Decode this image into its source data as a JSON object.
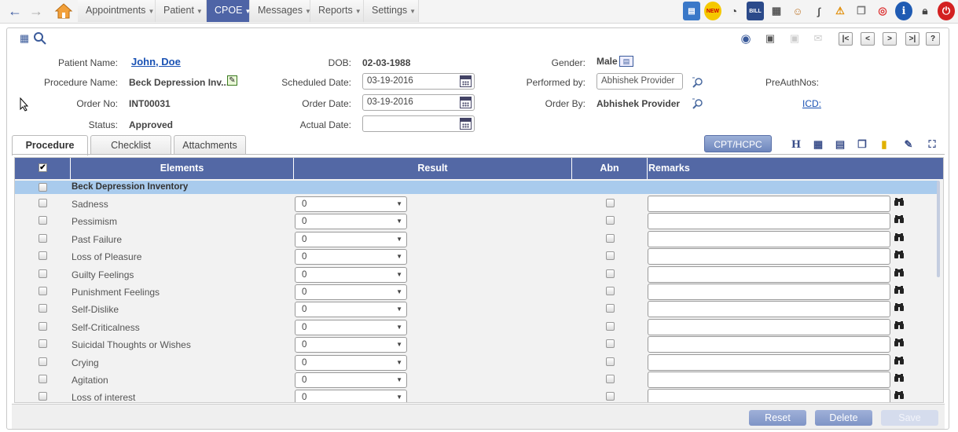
{
  "nav": {
    "back_icon": "back-arrow-icon",
    "forward_icon": "forward-arrow-icon",
    "home_icon": "home-icon",
    "menu": [
      {
        "label": "Appointments"
      },
      {
        "label": "Patient"
      },
      {
        "label": "CPOE"
      },
      {
        "label": "Messages"
      },
      {
        "label": "Reports"
      },
      {
        "label": "Settings"
      }
    ],
    "active_menu": "CPOE",
    "tool_new_label": "NEW",
    "tool_bill_label": "BILL"
  },
  "patient": {
    "name_label": "Patient Name:",
    "name": "John, Doe",
    "dob_label": "DOB:",
    "dob": "02-03-1988",
    "gender_label": "Gender:",
    "gender": "Male",
    "procedure_label": "Procedure Name:",
    "procedure": "Beck Depression Inv...",
    "scheduled_label": "Scheduled Date:",
    "scheduled": "03-19-2016",
    "performed_label": "Performed by:",
    "performed": "Abhishek Provider",
    "preauth_label": "PreAuthNos:",
    "order_no_label": "Order No:",
    "order_no": "INT00031",
    "order_date_label": "Order Date:",
    "order_date": "03-19-2016",
    "order_by_label": "Order By:",
    "order_by": "Abhishek Provider",
    "icd_label": "ICD:",
    "status_label": "Status:",
    "status": "Approved",
    "actual_label": "Actual Date:",
    "actual": ""
  },
  "tabs": [
    {
      "label": "Procedure"
    },
    {
      "label": "Checklist"
    },
    {
      "label": "Attachments"
    }
  ],
  "cpt_button": "CPT/HCPC",
  "table": {
    "headers": [
      "Elements",
      "Result",
      "Abn",
      "Remarks"
    ],
    "group": "Beck Depression Inventory",
    "rows": [
      {
        "element": "Sadness",
        "result": "0"
      },
      {
        "element": "Pessimism",
        "result": "0"
      },
      {
        "element": "Past Failure",
        "result": "0"
      },
      {
        "element": "Loss of Pleasure",
        "result": "0"
      },
      {
        "element": "Guilty Feelings",
        "result": "0"
      },
      {
        "element": "Punishment Feelings",
        "result": "0"
      },
      {
        "element": "Self-Dislike",
        "result": "0"
      },
      {
        "element": "Self-Criticalness",
        "result": "0"
      },
      {
        "element": "Suicidal Thoughts or Wishes",
        "result": "0"
      },
      {
        "element": "Crying",
        "result": "0"
      },
      {
        "element": "Agitation",
        "result": "0"
      },
      {
        "element": "Loss of interest",
        "result": "0"
      }
    ]
  },
  "footer": {
    "reset": "Reset",
    "delete": "Delete",
    "save": "Save"
  },
  "colors": {
    "accent": "#4e64a6",
    "group_row": "#a9cbed",
    "link": "#1a52b4"
  }
}
